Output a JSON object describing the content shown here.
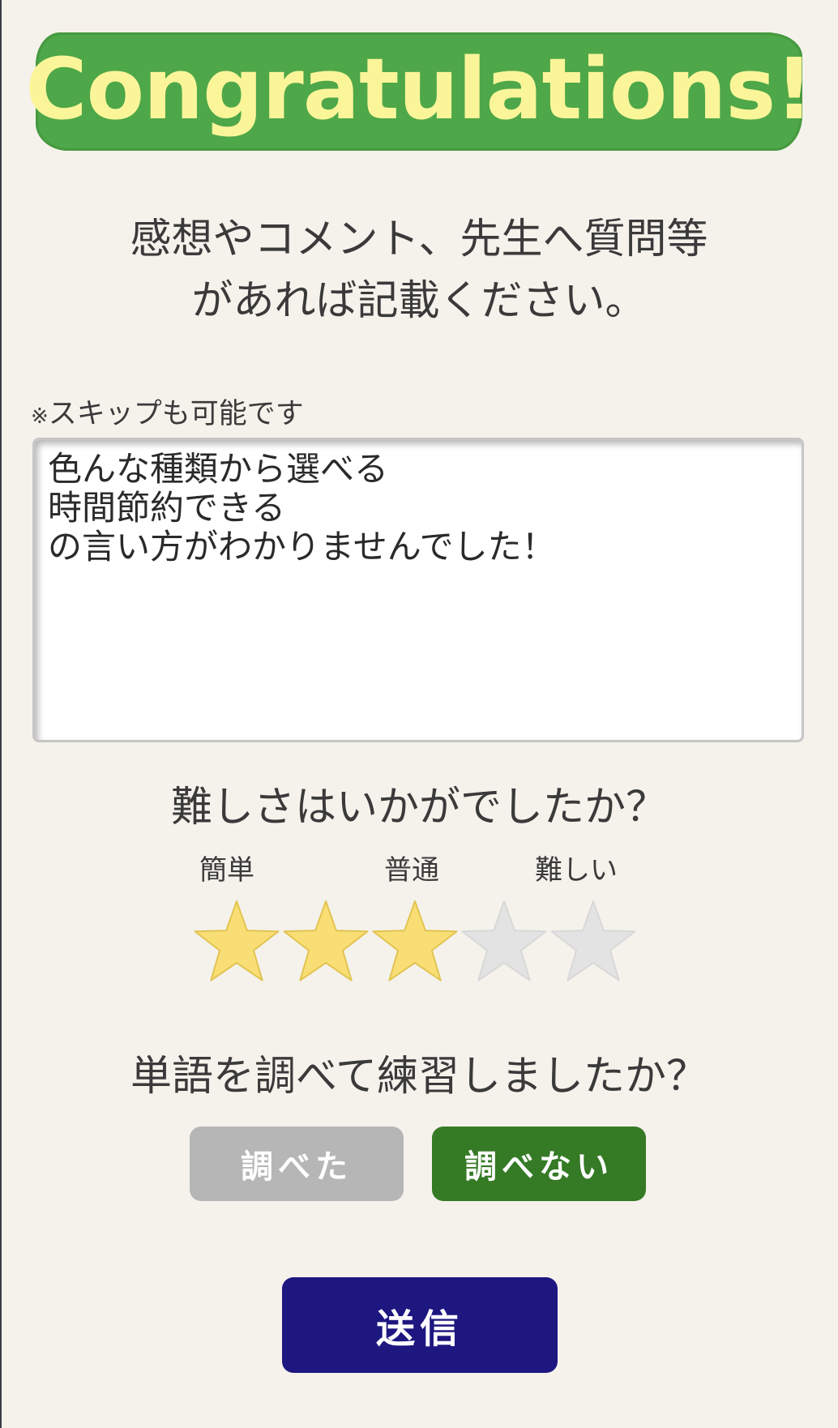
{
  "banner": {
    "text": "Congratulations!",
    "bg_color": "#4ea748",
    "text_color": "#fbf59a"
  },
  "prompt": {
    "line1": "感想やコメント、先生へ質問等",
    "line2": "があれば記載ください。"
  },
  "skip_note": {
    "mark": "※",
    "text": "スキップも可能です"
  },
  "comment": {
    "value": "色んな種類から選べる\n時間節約できる\nの言い方がわかりませんでした！"
  },
  "difficulty": {
    "question": "難しさはいかがでしたか？",
    "labels": {
      "easy": "簡単",
      "normal": "普通",
      "hard": "難しい"
    },
    "rating": 3,
    "max": 5,
    "filled_color": "#f8de75",
    "empty_color": "#e3e3e3"
  },
  "practice": {
    "question": "単語を調べて練習しましたか？",
    "option_yes": "調べた",
    "option_no": "調べない",
    "selected": "調べない",
    "selected_color": "#357a25",
    "unselected_color": "#b6b6b6"
  },
  "submit": {
    "label": "送信",
    "color": "#1e1780"
  }
}
